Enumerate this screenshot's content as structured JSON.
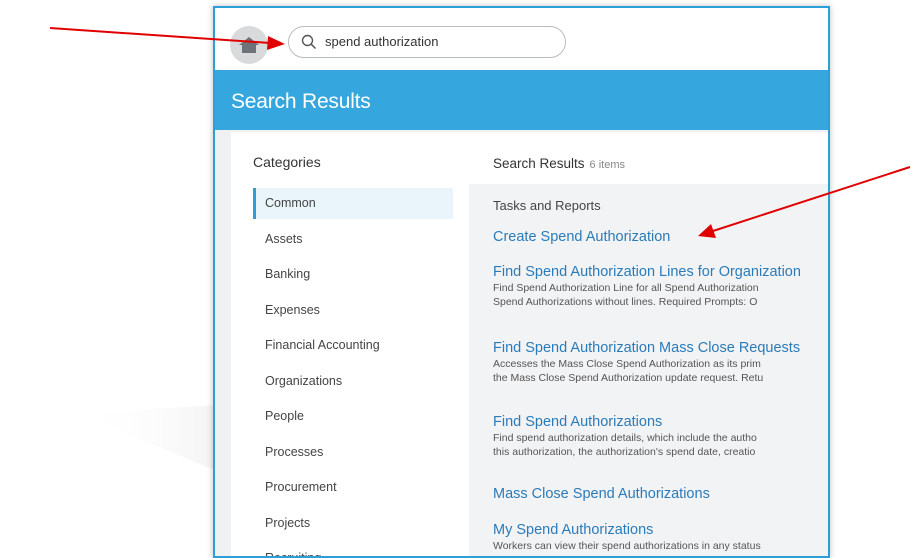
{
  "search": {
    "query": "spend authorization"
  },
  "page": {
    "title": "Search Results"
  },
  "categories": {
    "heading": "Categories",
    "items": [
      "Common",
      "Assets",
      "Banking",
      "Expenses",
      "Financial Accounting",
      "Organizations",
      "People",
      "Processes",
      "Procurement",
      "Projects",
      "Recruiting"
    ]
  },
  "results": {
    "heading": "Search Results",
    "count": "6 items",
    "section": "Tasks and Reports",
    "items": [
      {
        "title": "Create Spend Authorization",
        "desc1": "",
        "desc2": ""
      },
      {
        "title": "Find Spend Authorization Lines for Organization",
        "desc1": "Find Spend Authorization Line for all Spend Authorization",
        "desc2": "Spend Authorizations without lines. Required Prompts: O"
      },
      {
        "title": "Find Spend Authorization Mass Close Requests",
        "desc1": "Accesses the Mass Close Spend Authorization as its prim",
        "desc2": "the Mass Close Spend Authorization update request. Retu"
      },
      {
        "title": "Find Spend Authorizations",
        "desc1": "Find spend authorization details, which include the autho",
        "desc2": "this authorization, the authorization's spend date, creatio"
      },
      {
        "title": "Mass Close Spend Authorizations",
        "desc1": "",
        "desc2": ""
      },
      {
        "title": "My Spend Authorizations",
        "desc1": "Workers can view their spend authorizations in any status",
        "desc2": ""
      }
    ]
  },
  "colors": {
    "accent": "#36a6de",
    "link": "#2b7bb9",
    "annotation_arrow": "#e00000"
  }
}
